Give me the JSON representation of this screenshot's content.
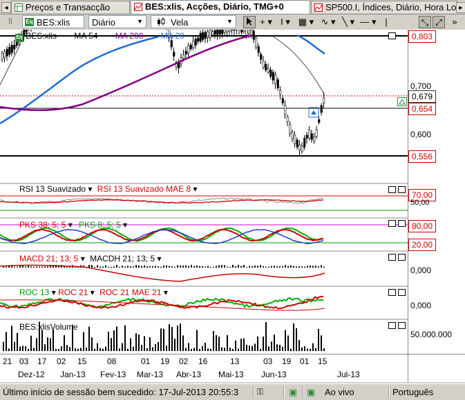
{
  "tabs": [
    {
      "label": "Preços e Transacção"
    },
    {
      "label": "BES:xlis, Acções, Diário, TMG+0"
    },
    {
      "label": "SP500.I, Índices, Diário, Hora Lo"
    }
  ],
  "toolbar": {
    "symbol": "BES:xlis",
    "symbol_badge": "Eq",
    "period": "Diário",
    "chart_type": "Vela",
    "tools": [
      "cursor",
      "crosshair",
      "text",
      "grid",
      "wave",
      "line",
      "hline",
      "zoom",
      "fit"
    ]
  },
  "price_panel": {
    "legend": [
      {
        "text": "BES:xlis",
        "color": "#000000"
      },
      {
        "text": "MA 54",
        "color": "#000000"
      },
      {
        "text": "MA 200",
        "color": "#800080"
      },
      {
        "text": "MA 20",
        "color": "#1e6ad6"
      }
    ],
    "badge": "Eq",
    "y_labels": [
      "0,700",
      "0,600"
    ],
    "boxes": [
      {
        "text": "0,803",
        "style": "red"
      },
      {
        "text": "0,679",
        "style": "dark"
      },
      {
        "text": "0,654",
        "style": "red"
      },
      {
        "text": "0,556",
        "style": "red"
      }
    ]
  },
  "rsi_panel": {
    "labels": [
      "RSI 13 Suavizado",
      "RSI 13 Suavizado MAE 8"
    ],
    "y_box": "70,00",
    "y_label": "50,00"
  },
  "pks_panel": {
    "labels": [
      "PKS 38; 5; 5",
      "PKS 8; 5; 5"
    ],
    "y_boxes": [
      "80,00",
      "20,00"
    ]
  },
  "macd_panel": {
    "labels": [
      "MACD 21; 13; 5",
      "MACDH 21; 13; 5"
    ],
    "y_label": "0,000"
  },
  "roc_panel": {
    "labels": [
      "ROC 13",
      "ROC 21",
      "ROC 21 MAE 21"
    ],
    "y_label": "0,000"
  },
  "volume_panel": {
    "label": "BES:xlisVolume",
    "y_label": "50.000.000"
  },
  "x_axis": {
    "days": [
      "21",
      "03",
      "17",
      "02",
      "15",
      "08",
      "01",
      "19",
      "02",
      "16",
      "13",
      "03",
      "19",
      "01",
      "15"
    ],
    "months": [
      "Dez-12",
      "Jan-13",
      "Fev-13",
      "Mar-13",
      "Abr-13",
      "Mai-13",
      "Jun-13",
      "Jul-13"
    ]
  },
  "status": {
    "login": "Último início de sessão bem sucedido: 17-Jul-2013 20:55:3",
    "live": "Ao vivo",
    "language": "Português"
  },
  "colors": {
    "candle_up": "#ffffff",
    "candle_down": "#000000",
    "rsi": "#c00000",
    "pks_fast": "#00b000",
    "pks_slow": "#d00000",
    "ma200": "#800080",
    "ma20": "#1e6ad6"
  }
}
